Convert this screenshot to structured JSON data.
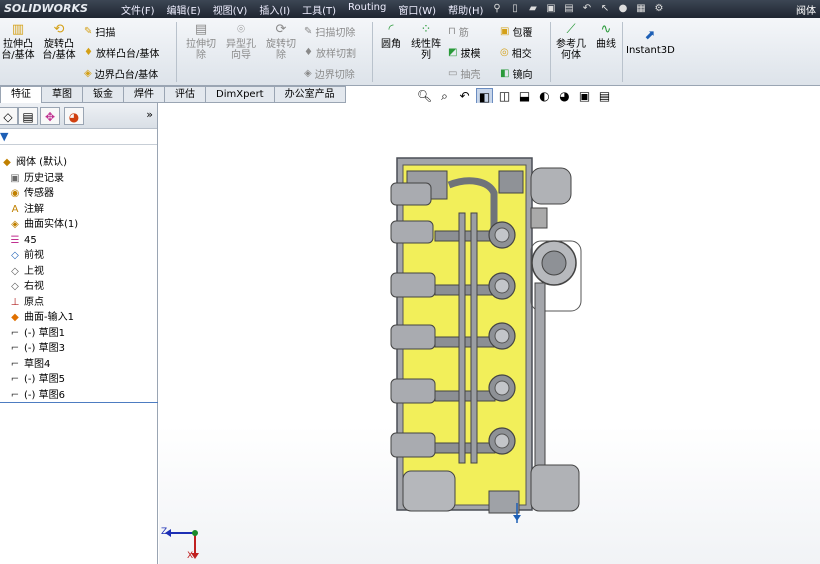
{
  "app": {
    "logo": "SOLIDWORKS",
    "title": "阀体"
  },
  "menu": [
    "文件(F)",
    "编辑(E)",
    "视图(V)",
    "插入(I)",
    "工具(T)",
    "Routing",
    "窗口(W)",
    "帮助(H)"
  ],
  "ribbon": {
    "extrude_boss": "拉伸凸台/基体",
    "revolve_boss": "旋转凸台/基体",
    "sweep": "扫描",
    "loft_boss": "放样凸台/基体",
    "boundary_boss": "边界凸台/基体",
    "extrude_cut": "拉伸切除",
    "hole_wizard": "异型孔向导",
    "revolve_cut": "旋转切除",
    "sweep_cut": "扫描切除",
    "loft_cut": "放样切割",
    "boundary_cut": "边界切除",
    "fillet": "圆角",
    "linear_pattern": "线性阵列",
    "rib": "筋",
    "draft": "拔模",
    "shell": "抽壳",
    "wrap": "包覆",
    "intersect": "相交",
    "mirror": "镜向",
    "ref_geometry": "参考几何体",
    "curves": "曲线",
    "instant3d": "Instant3D"
  },
  "tabs": [
    "特征",
    "草图",
    "钣金",
    "焊件",
    "评估",
    "DimXpert",
    "办公室产品"
  ],
  "tree": {
    "root": "阀体 (默认)",
    "items": [
      "历史记录",
      "传感器",
      "注解",
      "曲面实体(1)",
      "45",
      "前视",
      "上视",
      "右视",
      "原点",
      "曲面-输入1",
      "(-) 草图1",
      "(-) 草图3",
      "草图4",
      "(-) 草图5",
      "(-) 草图6"
    ]
  },
  "triad": {
    "z": "Z",
    "x": "X"
  },
  "colors": {
    "model_yellow": "#f2ef5a",
    "model_gray": "#9c9ea3",
    "accent": "#1d5fb5"
  }
}
